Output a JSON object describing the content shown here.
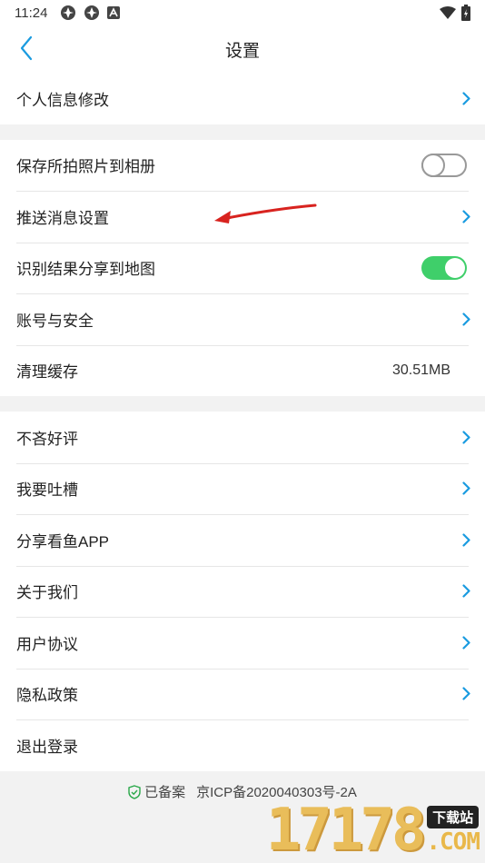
{
  "status": {
    "time": "11:24"
  },
  "header": {
    "title": "设置"
  },
  "group1": {
    "profile_edit": "个人信息修改"
  },
  "group2": {
    "save_photos": "保存所拍照片到相册",
    "push_settings": "推送消息设置",
    "share_to_map": "识别结果分享到地图",
    "account_security": "账号与安全",
    "clear_cache": "清理缓存",
    "cache_size": "30.51MB"
  },
  "toggles": {
    "save_photos_on": false,
    "share_to_map_on": true
  },
  "group3": {
    "rate_us": "不吝好评",
    "feedback": "我要吐槽",
    "share_app": "分享看鱼APP",
    "about_us": "关于我们",
    "user_agreement": "用户协议",
    "privacy_policy": "隐私政策",
    "logout": "退出登录"
  },
  "footer": {
    "filed": "已备案",
    "icp": "京ICP备2020040303号-2A"
  },
  "watermark": {
    "digits": "17178",
    "badge": "下载站",
    "domain": ".COM"
  },
  "colors": {
    "accent": "#1a9be0",
    "toggle_on": "#3fcf6a",
    "arrow": "#d8231f"
  }
}
